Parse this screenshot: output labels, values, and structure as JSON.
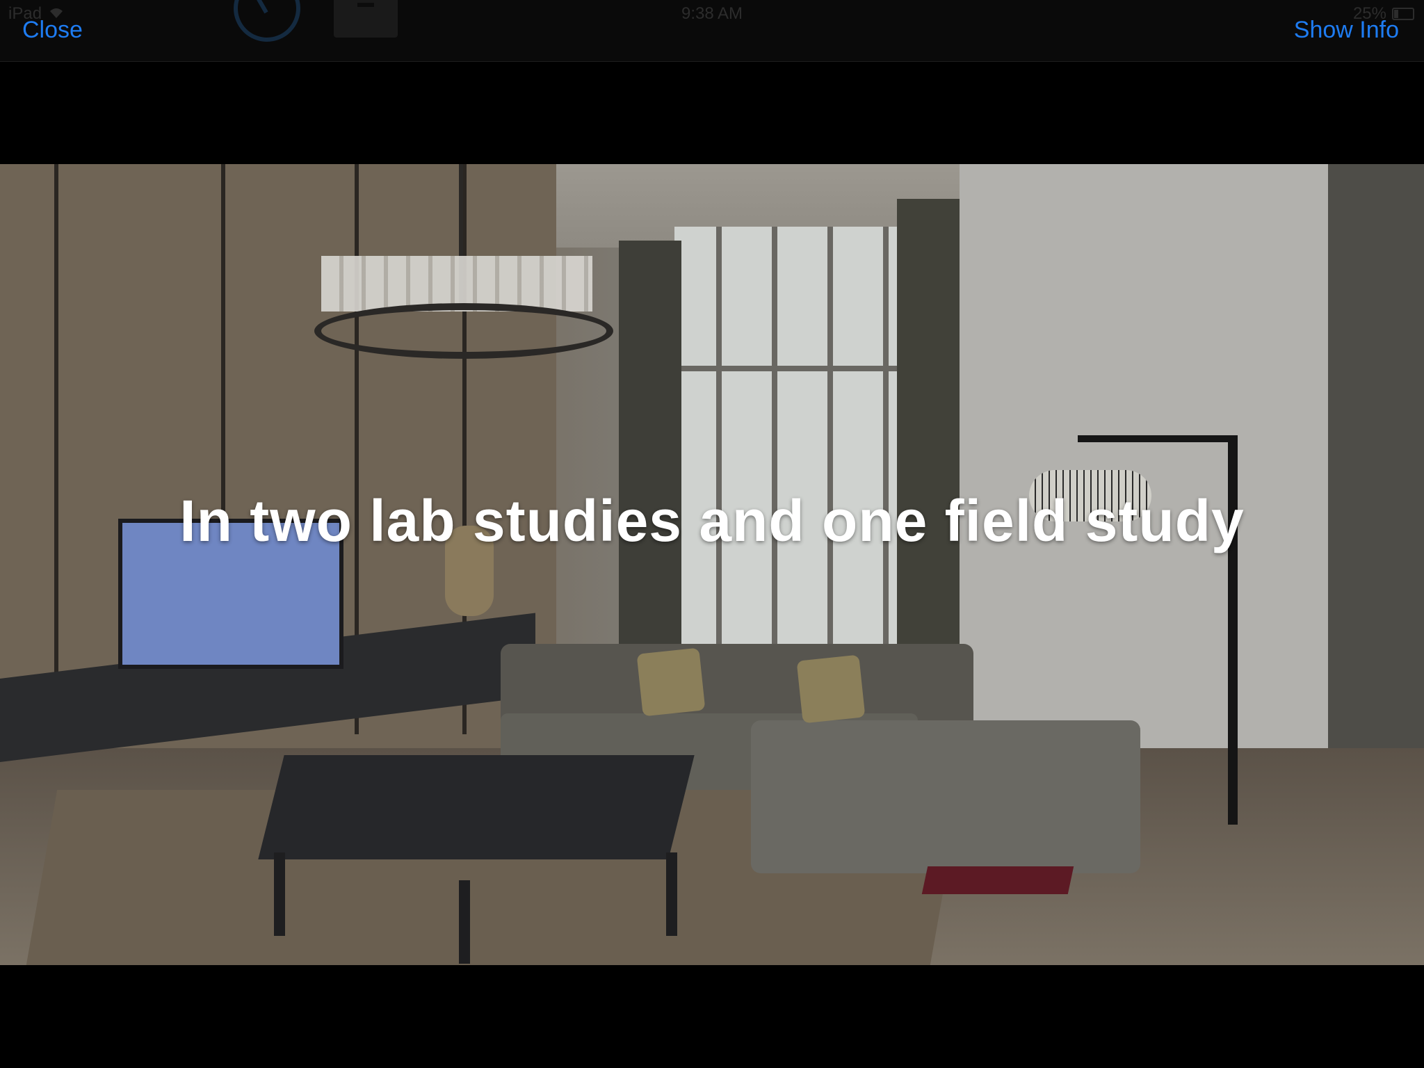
{
  "statusbar": {
    "device": "iPad",
    "time": "9:38 AM",
    "battery": "25%"
  },
  "navbar": {
    "close_label": "Close",
    "info_label": "Show Info"
  },
  "video": {
    "caption": "In two lab studies and one field study"
  },
  "icons": {
    "wifi": "wifi-icon",
    "battery": "battery-icon",
    "clock": "clock-icon",
    "box": "archive-icon"
  }
}
